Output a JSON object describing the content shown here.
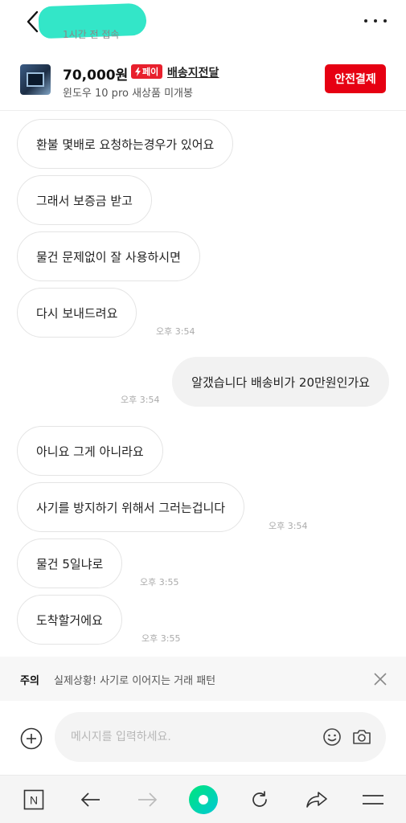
{
  "header": {
    "last_seen": "1시간 전 접속"
  },
  "product": {
    "price": "70,000원",
    "pay_badge": "페이",
    "delivery": "배송지전달",
    "title": "윈도우 10 pro 새상품 미개봉",
    "safe_pay_label": "안전결제"
  },
  "messages": [
    {
      "text": "환불 몇배로 요청하는경우가 있어요",
      "side": "theirs"
    },
    {
      "text": "그래서 보증금 받고",
      "side": "theirs"
    },
    {
      "text": "물건 문제없이 잘 사용하시면",
      "side": "theirs"
    },
    {
      "text": "다시 보내드려요",
      "side": "theirs",
      "time": "오후 3:54"
    },
    {
      "text": "알갰습니다 배송비가 20만원인가요",
      "side": "mine",
      "time": "오후 3:54"
    },
    {
      "text": "아니요 그게 아니라요",
      "side": "theirs"
    },
    {
      "text": "사기를 방지하기 위해서 그러는겁니다",
      "side": "theirs",
      "time": "오후 3:54"
    },
    {
      "text": "물건 5일냐로",
      "side": "theirs",
      "time": "오후 3:55"
    },
    {
      "text": "도착할거에요",
      "side": "theirs",
      "time": "오후 3:55"
    }
  ],
  "warning": {
    "title": "주의",
    "text": "실제상황! 사기로 이어지는 거래 패턴"
  },
  "composer": {
    "placeholder": "메시지를 입력하세요."
  },
  "nav": {
    "tabs_label": "N"
  },
  "colors": {
    "accent_red": "#e60012",
    "seller_name_redaction": "#33e6c8",
    "home_button": "#00e67a"
  }
}
